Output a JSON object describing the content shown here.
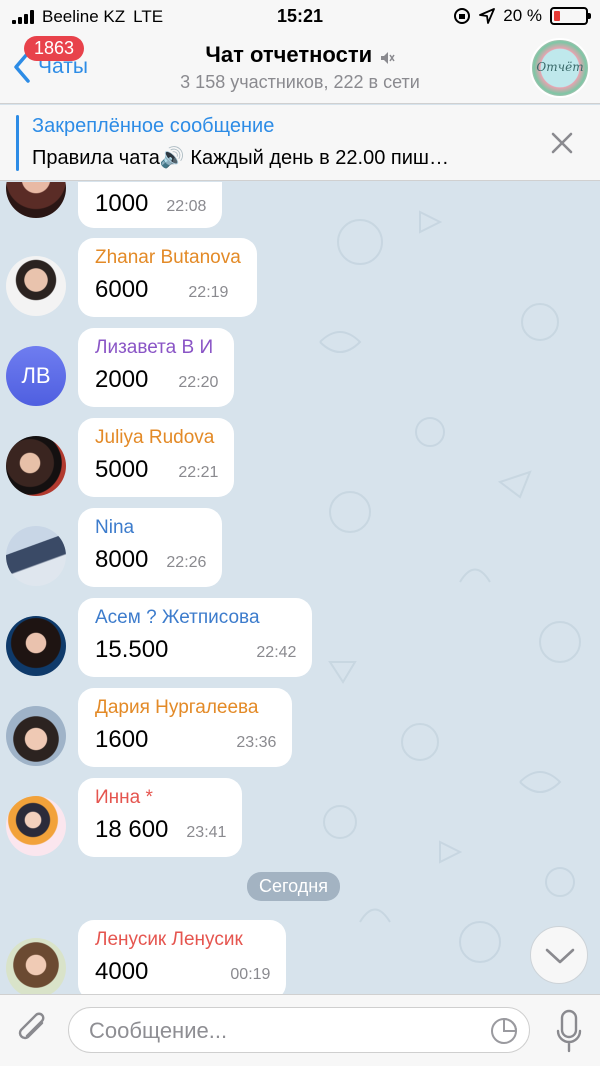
{
  "status": {
    "carrier": "Beeline KZ",
    "network": "LTE",
    "time": "15:21",
    "battery": "20 %",
    "battery_level": 0.2
  },
  "header": {
    "back_label": "Чаты",
    "unread_count": "1863",
    "title": "Чат отчетности",
    "subtitle": "3 158 участников, 222 в сети",
    "avatar_text": "Отчёт"
  },
  "pinned": {
    "title": "Закреплённое сообщение",
    "text": "Правила чата🔊 Каждый день в 22.00 пиш…"
  },
  "messages": [
    {
      "sender": "",
      "text": "1000",
      "time": "22:08"
    },
    {
      "sender": "Zhanar Butanova",
      "text": "6000",
      "time": "22:19",
      "color": "#e38a27"
    },
    {
      "sender": "Лизавета В И",
      "text": "2000",
      "time": "22:20",
      "color": "#8a55c6",
      "initials": "ЛВ"
    },
    {
      "sender": "Juliya Rudova",
      "text": "5000",
      "time": "22:21",
      "color": "#e38a27"
    },
    {
      "sender": "Nina",
      "text": "8000",
      "time": "22:26",
      "color": "#3d7ccc"
    },
    {
      "sender": "Асем ? Жетписова",
      "text": "15.500",
      "time": "22:42",
      "color": "#3d7ccc"
    },
    {
      "sender": "Дария Нургалеева",
      "text": "1600",
      "time": "23:36",
      "color": "#e38a27"
    },
    {
      "sender": "Инна *",
      "text": "18 600",
      "time": "23:41",
      "color": "#e5554f"
    },
    {
      "sender": "Ленусик Ленусик",
      "text": "4000",
      "time": "00:19",
      "color": "#e5554f"
    }
  ],
  "date_separator": "Сегодня",
  "composer": {
    "placeholder": "Сообщение..."
  }
}
